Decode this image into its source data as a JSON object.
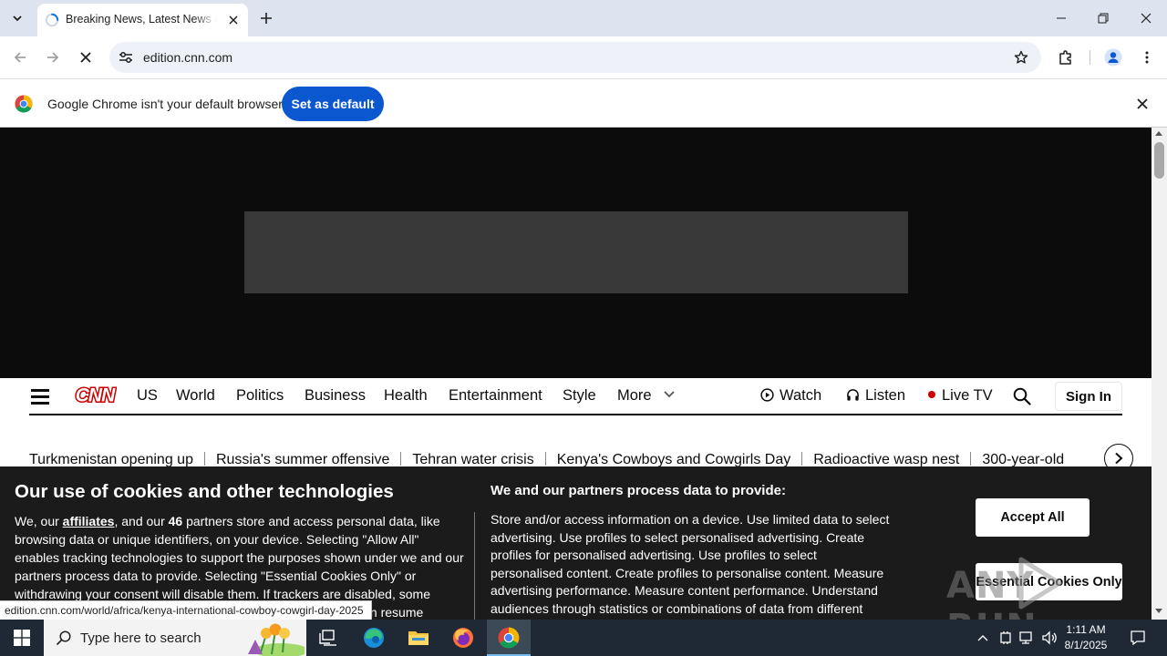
{
  "browser": {
    "tab": {
      "title": "Breaking News, Latest News and Videos | CNN"
    },
    "address": {
      "url": "edition.cnn.com"
    },
    "infobar": {
      "message": "Google Chrome isn't your default browser",
      "button_label": "Set as default"
    },
    "status_url": "edition.cnn.com/world/africa/kenya-international-cowboy-cowgirl-day-2025"
  },
  "cnn": {
    "logo_text": "CNN",
    "nav": {
      "links": [
        "US",
        "World",
        "Politics",
        "Business",
        "Health",
        "Entertainment",
        "Style",
        "More"
      ],
      "watch": "Watch",
      "listen": "Listen",
      "live_tv": "Live TV",
      "sign_in": "Sign In"
    },
    "trending": [
      "Turkmenistan opening up",
      "Russia's summer offensive",
      "Tehran water crisis",
      "Kenya's Cowboys and Cowgirls Day",
      "Radioactive wasp nest",
      "300-year-old"
    ]
  },
  "cookie_banner": {
    "heading": "Our use of cookies and other technologies",
    "body_part1": "We, our ",
    "affiliates_link": "affiliates",
    "body_part2": ", and our ",
    "partner_count": "46",
    "body_part3": " partners store and access personal data, like browsing data or unique identifiers, on your device. Selecting \"Allow All\" enables tracking technologies to support the purposes shown under we and our partners process data to provide. Selecting \"Essential Cookies Only\" or withdrawing your consent will disable them. If trackers are disabled, some content and ads you see may not be as relevant to you. You can resume tracking or withdraw",
    "purposes_heading": "We and our partners process data to provide:",
    "purposes_text": "Store and/or access information on a device. Use limited data to select advertising. Use profiles to select personalised advertising. Create profiles for personalised advertising. Use profiles to select personalised content. Create profiles to personalise content. Measure advertising performance. Measure content performance. Understand audiences through statistics or combinations of data from different sources. Develop and improve services.",
    "accept_all": "Accept All",
    "essential_only": "Essential Cookies Only"
  },
  "watermark": "ANY RUN",
  "taskbar": {
    "search_placeholder": "Type here to search",
    "time": "1:11 AM",
    "date": "8/1/2025"
  },
  "colors": {
    "cnn_red": "#cc0000",
    "chrome_blue": "#0b57d0",
    "tab_strip": "#dee3f0",
    "taskbar": "#1e2935"
  }
}
